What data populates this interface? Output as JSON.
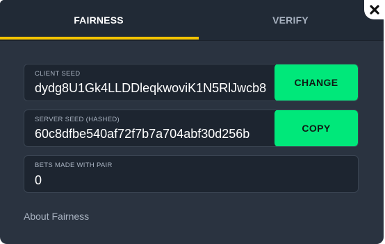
{
  "tabs": [
    {
      "label": "FAIRNESS",
      "active": true
    },
    {
      "label": "VERIFY",
      "active": false
    }
  ],
  "colors": {
    "accent_underline": "#f5c400",
    "action_button": "#00e87a",
    "panel_bg": "#2a3340",
    "field_bg": "#1d2530"
  },
  "close_icon": "close-x-icon",
  "client_seed": {
    "label": "CLIENT SEED",
    "value": "dydg8U1Gk4LLDDleqkwoviK1N5RlJwcb8",
    "button_label": "CHANGE"
  },
  "server_seed": {
    "label": "SERVER SEED (HASHED)",
    "value": "60c8dfbe540af72f7b7a704abf30d256b",
    "button_label": "COPY"
  },
  "bets": {
    "label": "BETS MADE WITH PAIR",
    "value": "0"
  },
  "about_link": "About Fairness"
}
